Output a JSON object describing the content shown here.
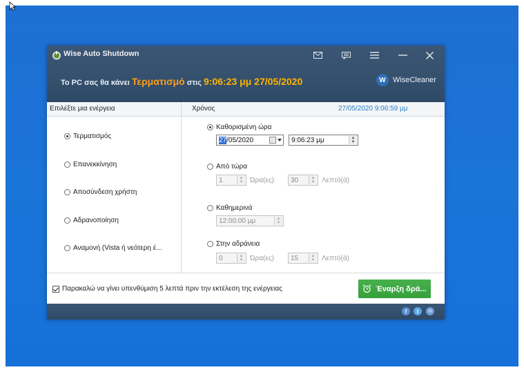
{
  "window": {
    "title": "Wise Auto Shutdown"
  },
  "message": {
    "prefix": "Το PC σας θα κάνει",
    "action": "Τερματισμό",
    "middle": "στις",
    "datetime": "9:06:23 μμ 27/05/2020"
  },
  "brand": {
    "logo_letter": "W",
    "name": "WiseCleaner"
  },
  "left_panel": {
    "header": "Επιλέξτε μια ενέργεια",
    "options": [
      {
        "label": "Τερματισμός",
        "selected": true
      },
      {
        "label": "Επανεκκίνηση",
        "selected": false
      },
      {
        "label": "Αποσύνδεση χρήστη",
        "selected": false
      },
      {
        "label": "Αδρανοποίηση",
        "selected": false
      },
      {
        "label": "Αναμονή (Vista ή νεότερη έ...",
        "selected": false
      }
    ]
  },
  "right_panel": {
    "header": "Χρόνος",
    "current_time": "27/05/2020 9:06:59 μμ",
    "specific_time": {
      "label": "Καθορισμένη ώρα",
      "selected": true,
      "date_highlight": "27",
      "date_rest": "/05/2020",
      "time": "9:06:23 μμ"
    },
    "from_now": {
      "label": "Από τώρα",
      "hours_value": "1",
      "hours_unit": "Ώρα(ες)",
      "minutes_value": "30",
      "minutes_unit": "Λεπτό(ά)"
    },
    "daily": {
      "label": "Καθημερινά",
      "time": "12:00:00 μμ"
    },
    "on_idle": {
      "label": "Στην αδράνεια",
      "hours_value": "0",
      "hours_unit": "Ώρα(ες)",
      "minutes_value": "15",
      "minutes_unit": "Λεπτό(ά)"
    }
  },
  "footer": {
    "reminder_label": "Παρακαλώ να γίνει υπενθύμιση 5 λεπτά πριν την εκτέλεση της ενέργειας",
    "reminder_checked": true,
    "start_button": "Έναρξη δρά..."
  },
  "social": {
    "facebook": "f",
    "twitter": "t",
    "email": "✉"
  },
  "colors": {
    "desktop": "#1b74d8",
    "titlebar": "#36526f",
    "accent_orange": "#ff9e1b",
    "accent_yellow": "#ffb400",
    "start_button": "#3ea843",
    "current_time_text": "#2a7fc8"
  }
}
